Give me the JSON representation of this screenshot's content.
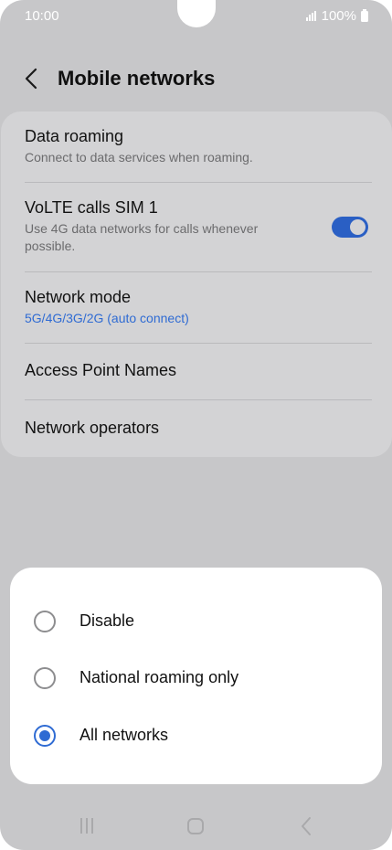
{
  "status": {
    "time": "10:00",
    "battery": "100%"
  },
  "header": {
    "title": "Mobile networks"
  },
  "settings": [
    {
      "title": "Data roaming",
      "subtitle": "Connect to data services when roaming."
    },
    {
      "title": "VoLTE calls SIM 1",
      "subtitle": "Use 4G data networks for calls whenever possible.",
      "toggle": true
    },
    {
      "title": "Network mode",
      "subtitle": "5G/4G/3G/2G (auto connect)"
    },
    {
      "title": "Access Point Names"
    },
    {
      "title": "Network operators"
    }
  ],
  "sheet": {
    "options": [
      {
        "label": "Disable",
        "selected": false
      },
      {
        "label": "National roaming only",
        "selected": false
      },
      {
        "label": "All networks",
        "selected": true
      }
    ]
  },
  "colors": {
    "accent": "#2f6bd3",
    "toggle_on": "#2a5fc4"
  }
}
